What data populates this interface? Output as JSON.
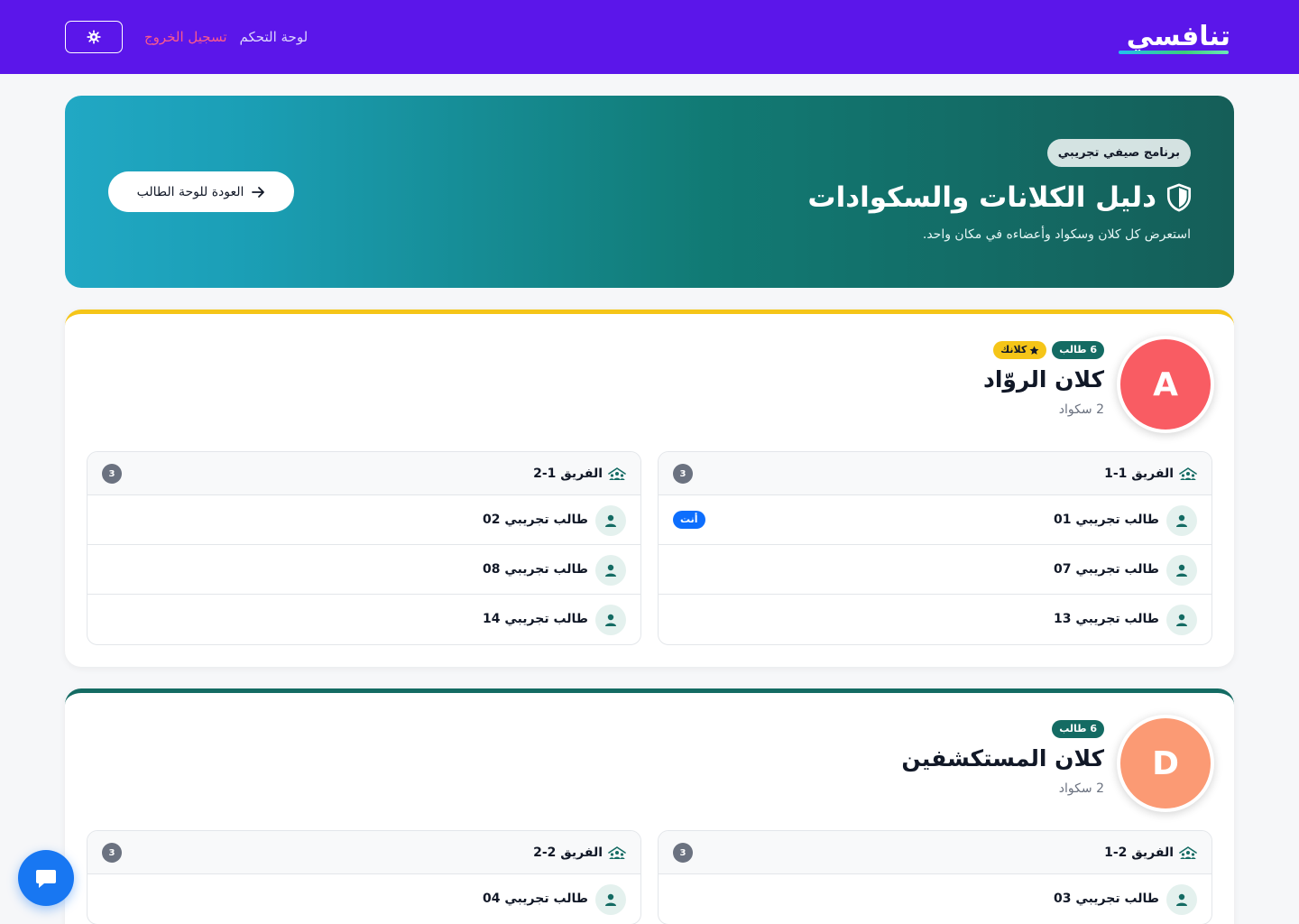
{
  "nav": {
    "logo": "تنافسي",
    "dashboard_label": "لوحة التحكم",
    "logout_label": "تسجيل الخروج",
    "theme_icon": "gear-icon"
  },
  "hero": {
    "badge": "برنامج صيفي تجريبي",
    "title": "دليل الكلانات والسكوادات",
    "subtitle": "استعرض كل كلان وسكواد وأعضاءه في مكان واحد.",
    "back_label": "العودة للوحة الطالب",
    "title_icon": "shield-icon",
    "back_icon": "arrow-right-icon"
  },
  "clans": [
    {
      "letter": "A",
      "name": "كلان الروّاد",
      "squads_label": "2 سكواد",
      "count_badge": "6 طالب",
      "yours_badge": "كلانك",
      "avatar_color": "#f95c63",
      "squads": [
        {
          "title": "الفريق 1-1",
          "count": "3",
          "members": [
            {
              "name": "طالب تجريبي 01",
              "you": "أنت"
            },
            {
              "name": "طالب تجريبي 07"
            },
            {
              "name": "طالب تجريبي 13"
            }
          ]
        },
        {
          "title": "الفريق 1-2",
          "count": "3",
          "members": [
            {
              "name": "طالب تجريبي 02"
            },
            {
              "name": "طالب تجريبي 08"
            },
            {
              "name": "طالب تجريبي 14"
            }
          ]
        }
      ]
    },
    {
      "letter": "D",
      "name": "كلان المستكشفين",
      "squads_label": "2 سكواد",
      "count_badge": "6 طالب",
      "avatar_color": "#fb9a74",
      "squads": [
        {
          "title": "الفريق 2-1",
          "count": "3",
          "members": [
            {
              "name": "طالب تجريبي 03"
            }
          ]
        },
        {
          "title": "الفريق 2-2",
          "count": "3",
          "members": [
            {
              "name": "طالب تجريبي 04"
            }
          ]
        }
      ]
    }
  ],
  "colors": {
    "nav_bg": "#5b16ea",
    "accent_teal": "#146b63",
    "gold": "#f5c518",
    "logout": "#fb5a8b",
    "you_badge": "#0d6efd"
  }
}
